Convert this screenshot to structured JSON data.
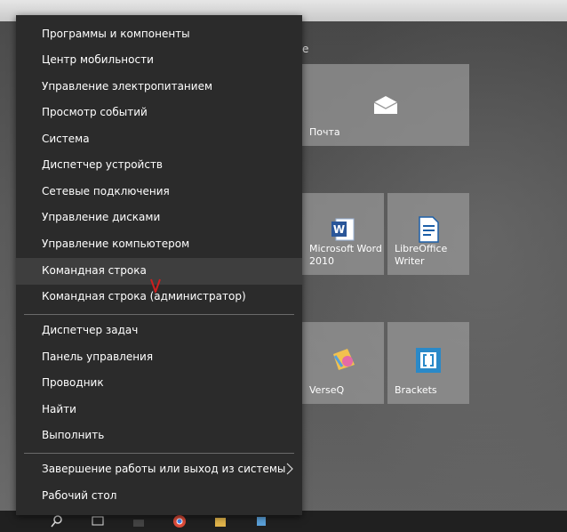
{
  "menu": {
    "items": [
      {
        "label": "Программы и компоненты"
      },
      {
        "label": "Центр мобильности"
      },
      {
        "label": "Управление электропитанием"
      },
      {
        "label": "Просмотр событий"
      },
      {
        "label": "Система"
      },
      {
        "label": "Диспетчер устройств"
      },
      {
        "label": "Сетевые подключения"
      },
      {
        "label": "Управление дисками"
      },
      {
        "label": "Управление компьютером"
      },
      {
        "label": "Командная строка"
      },
      {
        "label": "Командная строка (администратор)"
      },
      {
        "label": "Диспетчер задач"
      },
      {
        "label": "Панель управления"
      },
      {
        "label": "Проводник"
      },
      {
        "label": "Найти"
      },
      {
        "label": "Выполнить"
      },
      {
        "label": "Завершение работы или выход из системы"
      },
      {
        "label": "Рабочий стол"
      }
    ],
    "highlight_color": "#3e3e3e",
    "annotation_mark_color": "#cc1f1f"
  },
  "start": {
    "group_label": "е",
    "tiles": {
      "mail": {
        "label": "Почта",
        "icon": "mail-icon"
      },
      "word": {
        "label": "Microsoft Word\n2010",
        "icon": "word-icon"
      },
      "libreoffice": {
        "label": "LibreOffice\nWriter",
        "icon": "writer-icon"
      },
      "verseq": {
        "label": "VerseQ",
        "icon": "verseq-icon"
      },
      "brackets": {
        "label": "Brackets",
        "icon": "brackets-icon"
      }
    }
  }
}
